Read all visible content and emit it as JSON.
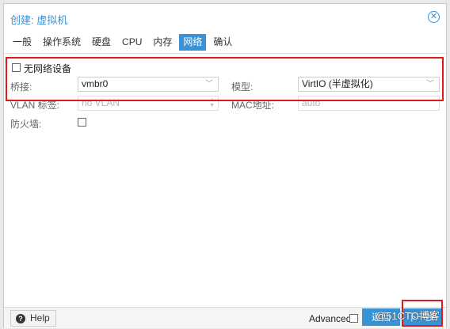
{
  "window": {
    "title": "创建: 虚拟机"
  },
  "tabs": [
    {
      "label": "一般"
    },
    {
      "label": "操作系统"
    },
    {
      "label": "硬盘"
    },
    {
      "label": "CPU"
    },
    {
      "label": "内存"
    },
    {
      "label": "网络",
      "active": true
    },
    {
      "label": "确认"
    }
  ],
  "form": {
    "no_network_label": "无网络设备",
    "bridge_label": "桥接:",
    "bridge_value": "vmbr0",
    "model_label": "模型:",
    "model_value": "VirtIO (半虚拟化)",
    "vlan_label": "VLAN 标签:",
    "vlan_placeholder": "no VLAN",
    "mac_label": "MAC地址:",
    "mac_placeholder": "auto",
    "firewall_label": "防火墙:"
  },
  "footer": {
    "help_label": "Help",
    "advanced_label": "Advanced",
    "back_label": "返回",
    "next_label": "下一步"
  },
  "watermark": "@51CTO博客",
  "icons": {
    "close": "close-circle-icon",
    "help": "question-circle-icon",
    "dropdown": "chevron-down-icon",
    "spinner": "spinner-arrows-icon"
  },
  "colors": {
    "accent": "#3892d4",
    "highlight_box": "#e0191c"
  }
}
